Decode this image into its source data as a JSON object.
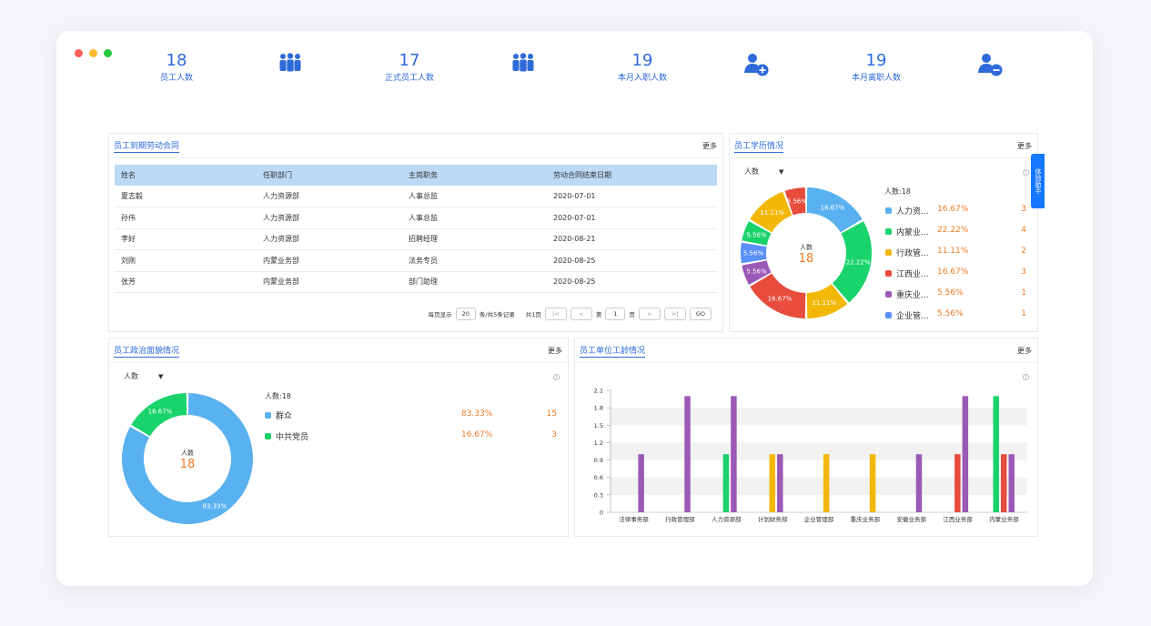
{
  "window_dots": [
    "#ff5f57",
    "#febc2e",
    "#28c840"
  ],
  "stats": [
    {
      "value": "18",
      "label": "员工人数",
      "icon": "group-icon"
    },
    {
      "value": "17",
      "label": "正式员工人数",
      "icon": "group-icon"
    },
    {
      "value": "19",
      "label": "本月入职人数",
      "icon": "user-add-icon"
    },
    {
      "value": "19",
      "label": "本月离职人数",
      "icon": "user-remove-icon"
    }
  ],
  "contract": {
    "title": "员工到期劳动合同",
    "more": "更多",
    "columns": [
      "姓名",
      "任职部门",
      "主岗职务",
      "劳动合同结束日期"
    ],
    "rows": [
      [
        "夏志毅",
        "人力资源部",
        "人事总监",
        "2020-07-01"
      ],
      [
        "孙伟",
        "人力资源部",
        "人事总监",
        "2020-07-01"
      ],
      [
        "李好",
        "人力资源部",
        "招聘经理",
        "2020-08-21"
      ],
      [
        "刘刚",
        "内蒙业务部",
        "法务专员",
        "2020-08-25"
      ],
      [
        "张芳",
        "内蒙业务部",
        "部门助理",
        "2020-08-25"
      ]
    ],
    "pager": {
      "per_page_label": "每页显示",
      "per_page": "20",
      "records_text": "条/共5条记录",
      "pages_text": "共1页",
      "first": "|<",
      "prev": "<",
      "page_prefix": "第",
      "page": "1",
      "page_suffix": "页",
      "next": ">",
      "last": ">|",
      "go": "GO"
    }
  },
  "education": {
    "title": "员工学历情况",
    "more": "更多",
    "select": "人数",
    "center_label": "人数",
    "center_value": "18",
    "total_label": "人数:18",
    "legend": [
      {
        "name": "人力资...",
        "pct": "16.67%",
        "count": "3",
        "color": "#5ab1ef"
      },
      {
        "name": "内蒙业...",
        "pct": "22.22%",
        "count": "4",
        "color": "#19d36b"
      },
      {
        "name": "行政管...",
        "pct": "11.11%",
        "count": "2",
        "color": "#f2b807"
      },
      {
        "name": "江西业...",
        "pct": "16.67%",
        "count": "3",
        "color": "#e74c3c"
      },
      {
        "name": "重庆业...",
        "pct": "5.56%",
        "count": "1",
        "color": "#9b59b6"
      },
      {
        "name": "企业管...",
        "pct": "5.56%",
        "count": "1",
        "color": "#5b8ff9"
      }
    ],
    "ring_labels": [
      "16.67%",
      "22.22%",
      "11.11%",
      "16.67%",
      "5.56%",
      "5.56%",
      "5.56%",
      "11.11%",
      "5.56%"
    ]
  },
  "politics": {
    "title": "员工政治面貌情况",
    "more": "更多",
    "select": "人数",
    "center_label": "人数",
    "center_value": "18",
    "total_label": "人数:18",
    "legend": [
      {
        "name": "群众",
        "pct": "83.33%",
        "count": "15",
        "color": "#5ab1ef"
      },
      {
        "name": "中共党员",
        "pct": "16.67%",
        "count": "3",
        "color": "#19d36b"
      }
    ],
    "ring_labels": [
      "83.33%",
      "16.67%"
    ]
  },
  "seniority": {
    "title": "员工单位工龄情况",
    "more": "更多"
  },
  "helper_label": "体验助手",
  "chart_data": [
    {
      "type": "pie",
      "labels": [
        "人力资...",
        "内蒙业...",
        "行政管...",
        "江西业...",
        "重庆业...",
        "企业管...",
        "",
        "",
        ""
      ],
      "values": [
        16.67,
        22.22,
        11.11,
        16.67,
        5.56,
        5.56,
        5.56,
        11.11,
        5.56
      ],
      "colors": [
        "#5ab1ef",
        "#19d36b",
        "#f2b807",
        "#e74c3c",
        "#9b59b6",
        "#5b8ff9",
        "#19d36b",
        "#f2b807",
        "#e74c3c"
      ]
    },
    {
      "type": "pie",
      "labels": [
        "群众",
        "中共党员"
      ],
      "values": [
        83.33,
        16.67
      ],
      "colors": [
        "#5ab1ef",
        "#19d36b"
      ]
    },
    {
      "type": "bar",
      "categories": [
        "法律事务部",
        "行政管理部",
        "人力资源部",
        "计划财务部",
        "企业管理部",
        "重庆业务部",
        "安徽业务部",
        "江西业务部",
        "内蒙业务部"
      ],
      "yticks": [
        "0",
        "0.3",
        "0.6",
        "0.9",
        "1.2",
        "1.5",
        "1.8",
        "2.1"
      ],
      "ylim": [
        0,
        2.1
      ],
      "bars": [
        {
          "category": 0,
          "value": 1,
          "color": "#9b59b6"
        },
        {
          "category": 1,
          "value": 2,
          "color": "#9b59b6"
        },
        {
          "category": 2,
          "value": 1,
          "color": "#19d36b"
        },
        {
          "category": 2,
          "value": 2,
          "color": "#9b59b6"
        },
        {
          "category": 3,
          "value": 1,
          "color": "#f2b807"
        },
        {
          "category": 3,
          "value": 1,
          "color": "#9b59b6"
        },
        {
          "category": 4,
          "value": 1,
          "color": "#f2b807"
        },
        {
          "category": 5,
          "value": 1,
          "color": "#f2b807"
        },
        {
          "category": 6,
          "value": 1,
          "color": "#9b59b6"
        },
        {
          "category": 7,
          "value": 1,
          "color": "#e74c3c"
        },
        {
          "category": 7,
          "value": 2,
          "color": "#9b59b6"
        },
        {
          "category": 8,
          "value": 2,
          "color": "#19d36b"
        },
        {
          "category": 8,
          "value": 1,
          "color": "#e74c3c"
        },
        {
          "category": 8,
          "value": 1,
          "color": "#9b59b6"
        }
      ]
    }
  ]
}
